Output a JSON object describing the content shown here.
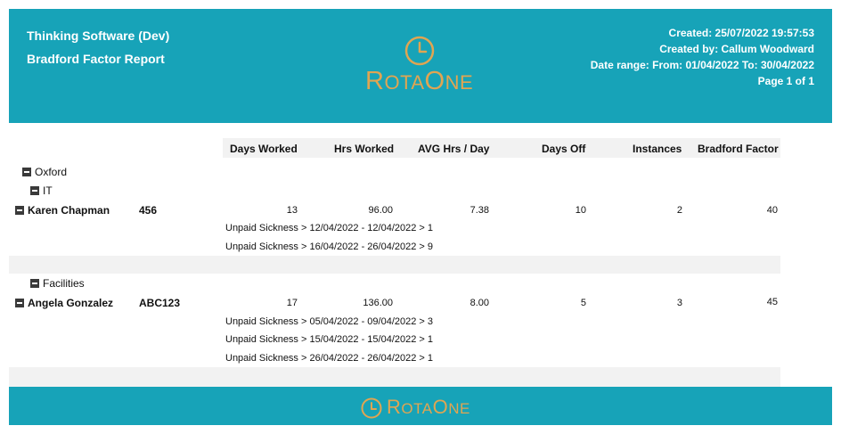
{
  "header": {
    "org": "Thinking Software (Dev)",
    "report_title": "Bradford Factor Report",
    "created": "Created: 25/07/2022 19:57:53",
    "created_by": "Created by: Callum Woodward",
    "date_range": "Date range: From: 01/04/2022 To: 30/04/2022",
    "page": "Page 1 of  1",
    "logo_text_big1": "R",
    "logo_text_small1": "OTA",
    "logo_text_big2": "O",
    "logo_text_small2": "NE",
    "logo_color": "#e0a552",
    "bg_color": "#17a3b8"
  },
  "columns": [
    "Days Worked",
    "Hrs Worked",
    "AVG Hrs / Day",
    "Days Off",
    "Instances",
    "Bradford Factor"
  ],
  "groups": [
    {
      "location": "Oxford",
      "department": "IT",
      "employee": {
        "name": "Karen Chapman",
        "id": "456",
        "days_worked": "13",
        "hrs_worked": "96.00",
        "avg_hrs_day": "7.38",
        "days_off": "10",
        "instances": "2",
        "bradford_factor": "40",
        "details": [
          "Unpaid Sickness > 12/04/2022 - 12/04/2022 > 1",
          "Unpaid Sickness > 16/04/2022 - 26/04/2022 > 9"
        ]
      }
    },
    {
      "department": "Facilities",
      "employee": {
        "name": "Angela Gonzalez",
        "id": "ABC123",
        "days_worked": "17",
        "hrs_worked": "136.00",
        "avg_hrs_day": "8.00",
        "days_off": "5",
        "instances": "3",
        "bradford_factor": "45",
        "details": [
          "Unpaid Sickness > 05/04/2022 - 09/04/2022 > 3",
          "Unpaid Sickness > 15/04/2022 - 15/04/2022 > 1",
          "Unpaid Sickness > 26/04/2022 - 26/04/2022 > 1"
        ]
      }
    }
  ]
}
